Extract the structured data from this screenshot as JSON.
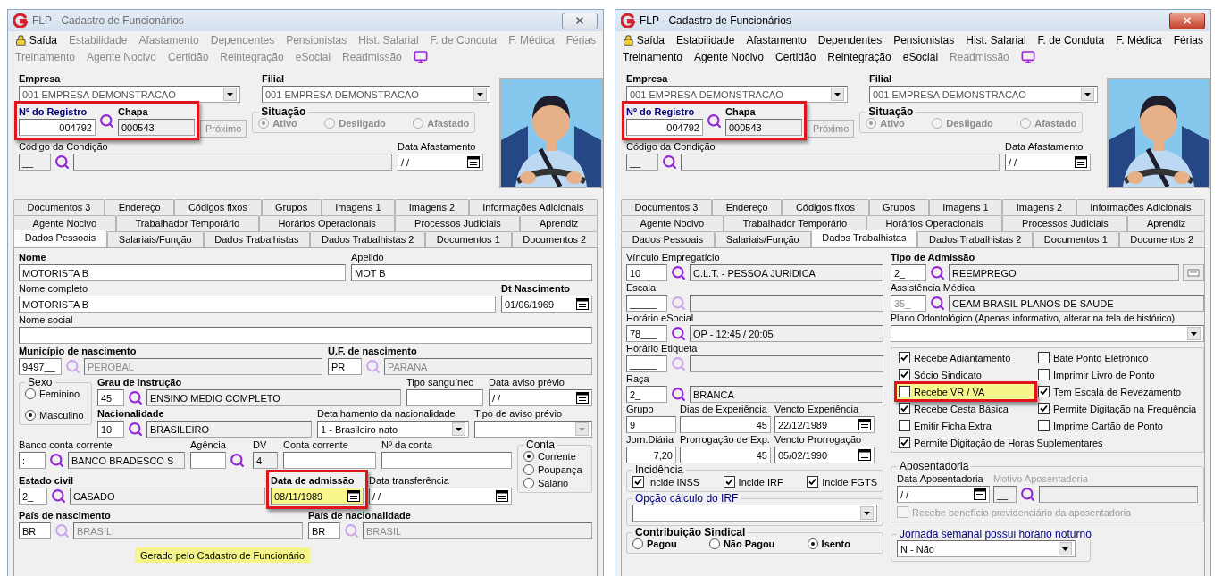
{
  "windows": [
    {
      "active": false,
      "title": "FLP - Cadastro de Funcionários",
      "menu": [
        [
          {
            "label": "Saída",
            "disabled": false
          },
          {
            "label": "Estabilidade",
            "disabled": true
          },
          {
            "label": "Afastamento",
            "disabled": true
          },
          {
            "label": "Dependentes",
            "disabled": true
          },
          {
            "label": "Pensionistas",
            "disabled": true
          },
          {
            "label": "Hist. Salarial",
            "disabled": true
          },
          {
            "label": "F. de Conduta",
            "disabled": true
          },
          {
            "label": "F. Médica",
            "disabled": true
          },
          {
            "label": "Férias",
            "disabled": true
          }
        ],
        [
          {
            "label": "Treinamento",
            "disabled": true
          },
          {
            "label": "Agente Nocivo",
            "disabled": true
          },
          {
            "label": "Certidão",
            "disabled": true
          },
          {
            "label": "Reintegração",
            "disabled": true
          },
          {
            "label": "eSocial",
            "disabled": true
          },
          {
            "label": "Readmissão",
            "disabled": true
          }
        ]
      ],
      "header": {
        "empresa": {
          "label": "Empresa",
          "value": "001 EMPRESA DEMONSTRACAO"
        },
        "filial": {
          "label": "Filial",
          "value": "001 EMPRESA DEMONSTRACAO"
        },
        "registration": {
          "highlighted": true,
          "number": {
            "label": "Nº do Registro",
            "value": "004792"
          },
          "chapa": {
            "label": "Chapa",
            "value": "000543"
          }
        },
        "next_button": "Próximo",
        "situacao": {
          "title": "Situação",
          "options": [
            {
              "label": "Ativo",
              "selected": true
            },
            {
              "label": "Desligado",
              "selected": false
            },
            {
              "label": "Afastado",
              "selected": false
            }
          ]
        },
        "condicao": {
          "label": "Código da Condição",
          "code": "__"
        },
        "data_afastamento": {
          "label": "Data Afastamento",
          "value": "/ /"
        }
      },
      "tabs": [
        [
          {
            "label": "Documentos 3",
            "selected": false
          },
          {
            "label": "Endereço",
            "selected": false
          },
          {
            "label": "Códigos fixos",
            "selected": false
          },
          {
            "label": "Grupos",
            "selected": false
          },
          {
            "label": "Imagens 1",
            "selected": false
          },
          {
            "label": "Imagens 2",
            "selected": false
          },
          {
            "label": "Informações Adicionais",
            "selected": false
          }
        ],
        [
          {
            "label": "Agente Nocivo",
            "selected": false
          },
          {
            "label": "Trabalhador Temporário",
            "selected": false
          },
          {
            "label": "Horários Operacionais",
            "selected": false
          },
          {
            "label": "Processos Judiciais",
            "selected": false
          },
          {
            "label": "Aprendiz",
            "selected": false
          }
        ],
        [
          {
            "label": "Dados Pessoais",
            "selected": true
          },
          {
            "label": "Salariais/Função",
            "selected": false
          },
          {
            "label": "Dados Trabalhistas",
            "selected": false
          },
          {
            "label": "Dados Trabalhistas 2",
            "selected": false
          },
          {
            "label": "Documentos 1",
            "selected": false
          },
          {
            "label": "Documentos 2",
            "selected": false
          }
        ]
      ],
      "panel": {
        "kind": "pessoais",
        "nome": {
          "label": "Nome",
          "value": "MOTORISTA B"
        },
        "apelido": {
          "label": "Apelido",
          "value": "MOT B"
        },
        "nome_completo": {
          "label": "Nome completo",
          "value": "MOTORISTA B"
        },
        "dt_nascimento": {
          "label": "Dt Nascimento",
          "value": "01/06/1969"
        },
        "nome_social": {
          "label": "Nome social"
        },
        "municipio": {
          "label": "Município de nascimento",
          "code": "9497__",
          "description": "PEROBAL",
          "disabled": true
        },
        "uf": {
          "label": "U.F. de nascimento",
          "code": "PR",
          "description": "PARANA",
          "disabled": true
        },
        "sexo": {
          "title": "Sexo",
          "options": [
            {
              "label": "Feminino",
              "selected": false
            },
            {
              "label": "Masculino",
              "selected": true
            }
          ]
        },
        "grau_instrucao": {
          "label": "Grau de instrução",
          "code": "45",
          "description": "ENSINO MEDIO COMPLETO",
          "disabled": false
        },
        "tipo_sanguineo": {
          "label": "Tipo sanguíneo"
        },
        "data_aviso_previo": {
          "label": "Data aviso prévio",
          "value": "/ /"
        },
        "nacionalidade": {
          "label": "Nacionalidade",
          "code": "10",
          "description": "BRASILEIRO",
          "disabled": false
        },
        "detalhamento": {
          "label": "Detalhamento da nacionalidade",
          "value": "1 - Brasileiro nato"
        },
        "tipo_aviso_previo": {
          "label": "Tipo de aviso prévio"
        },
        "banco": {
          "label": "Banco conta corrente",
          "code": ":",
          "description": "BANCO BRADESCO S",
          "disabled": false
        },
        "agencia": {
          "label": "Agência"
        },
        "dv": {
          "label": "DV",
          "value": "4"
        },
        "conta_corrente": {
          "label": "Conta corrente"
        },
        "numero_conta": {
          "label": "Nº da conta"
        },
        "conta": {
          "title": "Conta",
          "options": [
            {
              "label": "Corrente",
              "selected": true
            },
            {
              "label": "Poupança",
              "selected": false
            },
            {
              "label": "Salário",
              "selected": false
            }
          ]
        },
        "estado_civil": {
          "label": "Estado civil",
          "code": "2_",
          "description": "CASADO",
          "disabled": false
        },
        "data_admissao": {
          "label": "Data de admissão",
          "value": "08/11/1989",
          "highlighted": true
        },
        "data_transferencia": {
          "label": "Data transferência",
          "value": "/ /"
        },
        "pais_nascimento": {
          "label": "País de nascimento",
          "code": "BR",
          "description": "BRASIL",
          "disabled": true
        },
        "pais_nacionalidade": {
          "label": "País de nacionalidade",
          "code": "BR",
          "description": "BRASIL",
          "disabled": true
        },
        "note": "Gerado pelo Cadastro de Funcionário"
      }
    },
    {
      "active": true,
      "title": "FLP - Cadastro de Funcionários",
      "menu": [
        [
          {
            "label": "Saída",
            "disabled": false
          },
          {
            "label": "Estabilidade",
            "disabled": false
          },
          {
            "label": "Afastamento",
            "disabled": false
          },
          {
            "label": "Dependentes",
            "disabled": false
          },
          {
            "label": "Pensionistas",
            "disabled": false
          },
          {
            "label": "Hist. Salarial",
            "disabled": false
          },
          {
            "label": "F. de Conduta",
            "disabled": false
          },
          {
            "label": "F. Médica",
            "disabled": false
          },
          {
            "label": "Férias",
            "disabled": false
          }
        ],
        [
          {
            "label": "Treinamento",
            "disabled": false
          },
          {
            "label": "Agente Nocivo",
            "disabled": false
          },
          {
            "label": "Certidão",
            "disabled": false
          },
          {
            "label": "Reintegração",
            "disabled": false
          },
          {
            "label": "eSocial",
            "disabled": false
          },
          {
            "label": "Readmissão",
            "disabled": true
          }
        ]
      ],
      "header": {
        "empresa": {
          "label": "Empresa",
          "value": "001 EMPRESA DEMONSTRACAO"
        },
        "filial": {
          "label": "Filial",
          "value": "001 EMPRESA DEMONSTRACAO"
        },
        "registration": {
          "highlighted": true,
          "number": {
            "label": "Nº do Registro",
            "value": "004792"
          },
          "chapa": {
            "label": "Chapa",
            "value": "000543"
          }
        },
        "next_button": "Próximo",
        "situacao": {
          "title": "Situação",
          "options": [
            {
              "label": "Ativo",
              "selected": true
            },
            {
              "label": "Desligado",
              "selected": false
            },
            {
              "label": "Afastado",
              "selected": false
            }
          ]
        },
        "condicao": {
          "label": "Código da Condição",
          "code": "__"
        },
        "data_afastamento": {
          "label": "Data Afastamento",
          "value": "/ /"
        }
      },
      "tabs": [
        [
          {
            "label": "Documentos 3",
            "selected": false
          },
          {
            "label": "Endereço",
            "selected": false
          },
          {
            "label": "Códigos fixos",
            "selected": false
          },
          {
            "label": "Grupos",
            "selected": false
          },
          {
            "label": "Imagens 1",
            "selected": false
          },
          {
            "label": "Imagens 2",
            "selected": false
          },
          {
            "label": "Informações Adicionais",
            "selected": false
          }
        ],
        [
          {
            "label": "Agente Nocivo",
            "selected": false
          },
          {
            "label": "Trabalhador Temporário",
            "selected": false
          },
          {
            "label": "Horários Operacionais",
            "selected": false
          },
          {
            "label": "Processos Judiciais",
            "selected": false
          },
          {
            "label": "Aprendiz",
            "selected": false
          }
        ],
        [
          {
            "label": "Dados Pessoais",
            "selected": false
          },
          {
            "label": "Salariais/Função",
            "selected": false
          },
          {
            "label": "Dados Trabalhistas",
            "selected": true
          },
          {
            "label": "Dados Trabalhistas 2",
            "selected": false
          },
          {
            "label": "Documentos 1",
            "selected": false
          },
          {
            "label": "Documentos 2",
            "selected": false
          }
        ]
      ],
      "panel": {
        "kind": "trabalhistas",
        "vinculo": {
          "label": "Vínculo Empregatício",
          "code": "10",
          "description": "C.L.T. - PESSOA JURIDICA",
          "disabled": false
        },
        "escala": {
          "label": "Escala",
          "code": "_____",
          "disabled": true
        },
        "horario_esocial": {
          "label": "Horário eSocial",
          "code": "78___",
          "description": "OP - 12:45 / 20:05",
          "disabled": false
        },
        "horario_etiqueta": {
          "label": "Horário Etiqueta",
          "code": "_____",
          "disabled": true
        },
        "raca": {
          "label": "Raça",
          "code": "2_",
          "description": "BRANCA",
          "disabled": false
        },
        "grupo": {
          "label": "Grupo",
          "value": "9"
        },
        "dias_experiencia": {
          "label": "Dias de Experiência",
          "value": "45"
        },
        "vencto_experiencia": {
          "label": "Vencto Experiência",
          "value": "22/12/1989"
        },
        "jornada_diaria": {
          "label": "Jorn.Diária",
          "value": "7,20"
        },
        "prorrogacao": {
          "label": "Prorrogação de Exp.",
          "value": "45"
        },
        "vencto_prorrogacao": {
          "label": "Vencto Prorrogação",
          "value": "05/02/1990"
        },
        "incidencia": {
          "title": "Incidência",
          "items": [
            {
              "label": "Incide INSS",
              "checked": true
            },
            {
              "label": "Incide IRF",
              "checked": true
            },
            {
              "label": "Incide FGTS",
              "checked": true
            }
          ]
        },
        "opcao_irf": {
          "title": "Opção cálculo do IRF"
        },
        "contribuicao": {
          "title": "Contribuição Sindical",
          "options": [
            {
              "label": "Pagou",
              "selected": false
            },
            {
              "label": "Não Pagou",
              "selected": false
            },
            {
              "label": "Isento",
              "selected": true
            }
          ]
        },
        "tipo_admissao": {
          "label": "Tipo de Admissão",
          "code": "2_",
          "description": "REEMPREGO",
          "disabled": false
        },
        "assistencia": {
          "label": "Assistência Médica",
          "code": "35_",
          "description": "CEAM BRASIL PLANOS DE SAUDE",
          "disabled": false
        },
        "plano_odontologico": {
          "label": "Plano Odontológico (Apenas informativo, alterar na tela de histórico)"
        },
        "flags": [
          {
            "label": "Recebe Adiantamento",
            "checked": true,
            "highlighted": false
          },
          {
            "label": "Bate Ponto Eletrônico",
            "checked": false,
            "highlighted": false
          },
          {
            "label": "Sócio Sindicato",
            "checked": true,
            "highlighted": false
          },
          {
            "label": "Imprimir Livro de Ponto",
            "checked": false,
            "highlighted": false
          },
          {
            "label": "Recebe VR / VA",
            "checked": false,
            "highlighted": true
          },
          {
            "label": "Tem Escala de Revezamento",
            "checked": true,
            "highlighted": false
          },
          {
            "label": "Recebe Cesta Básica",
            "checked": true,
            "highlighted": false
          },
          {
            "label": "Permite Digitação na Frequência",
            "checked": true,
            "highlighted": false
          },
          {
            "label": "Emitir Ficha Extra",
            "checked": false,
            "highlighted": false
          },
          {
            "label": "Imprime Cartão de Ponto",
            "checked": false,
            "highlighted": false
          },
          {
            "label": "Permite Digitação de Horas Suplementares",
            "checked": true,
            "highlighted": false
          }
        ],
        "aposentadoria": {
          "title": "Aposentadoria",
          "data": {
            "label": "Data Aposentadoria",
            "value": "/ /"
          },
          "motivo": {
            "label": "Motivo Aposentadoria",
            "code": "__"
          },
          "beneficio": {
            "label": "Recebe benefício previdenciário da aposentadoria",
            "checked": false
          }
        },
        "jornada_noturno": {
          "title": "Jornada semanal possui horário noturno",
          "value": "N - Não"
        }
      }
    }
  ]
}
